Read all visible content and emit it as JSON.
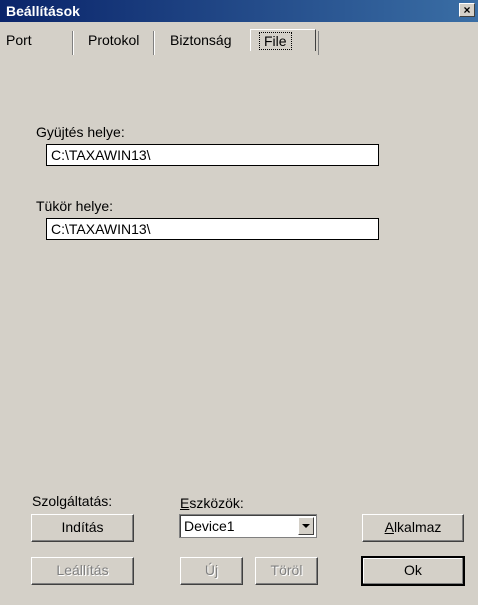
{
  "window": {
    "title": "Beállítások",
    "close_label": "×"
  },
  "tabs": [
    {
      "label": "Port",
      "active": false
    },
    {
      "label": "Protokol",
      "active": false
    },
    {
      "label": "Biztonság",
      "active": false
    },
    {
      "label": "File",
      "active": true
    }
  ],
  "file_tab": {
    "gyujtes_label": "Gyüjtés helye:",
    "gyujtes_value": "C:\\TAXAWIN13\\",
    "tukor_label": "Tükör helye:",
    "tukor_value": "C:\\TAXAWIN13\\"
  },
  "service": {
    "label": "Szolgáltatás:",
    "start_label": "Indítás",
    "stop_label": "Leállítás"
  },
  "devices": {
    "label_first": "E",
    "label_rest": "szközök:",
    "selected": "Device1",
    "new_label": "Új",
    "delete_label": "Töröl"
  },
  "actions": {
    "apply_first": "A",
    "apply_rest": "lkalmaz",
    "ok_label": "Ok"
  },
  "colors": {
    "titlebar_start": "#0a246a",
    "titlebar_end": "#3a6ea5",
    "face": "#d4d0c8",
    "disabled_text": "#808080"
  }
}
